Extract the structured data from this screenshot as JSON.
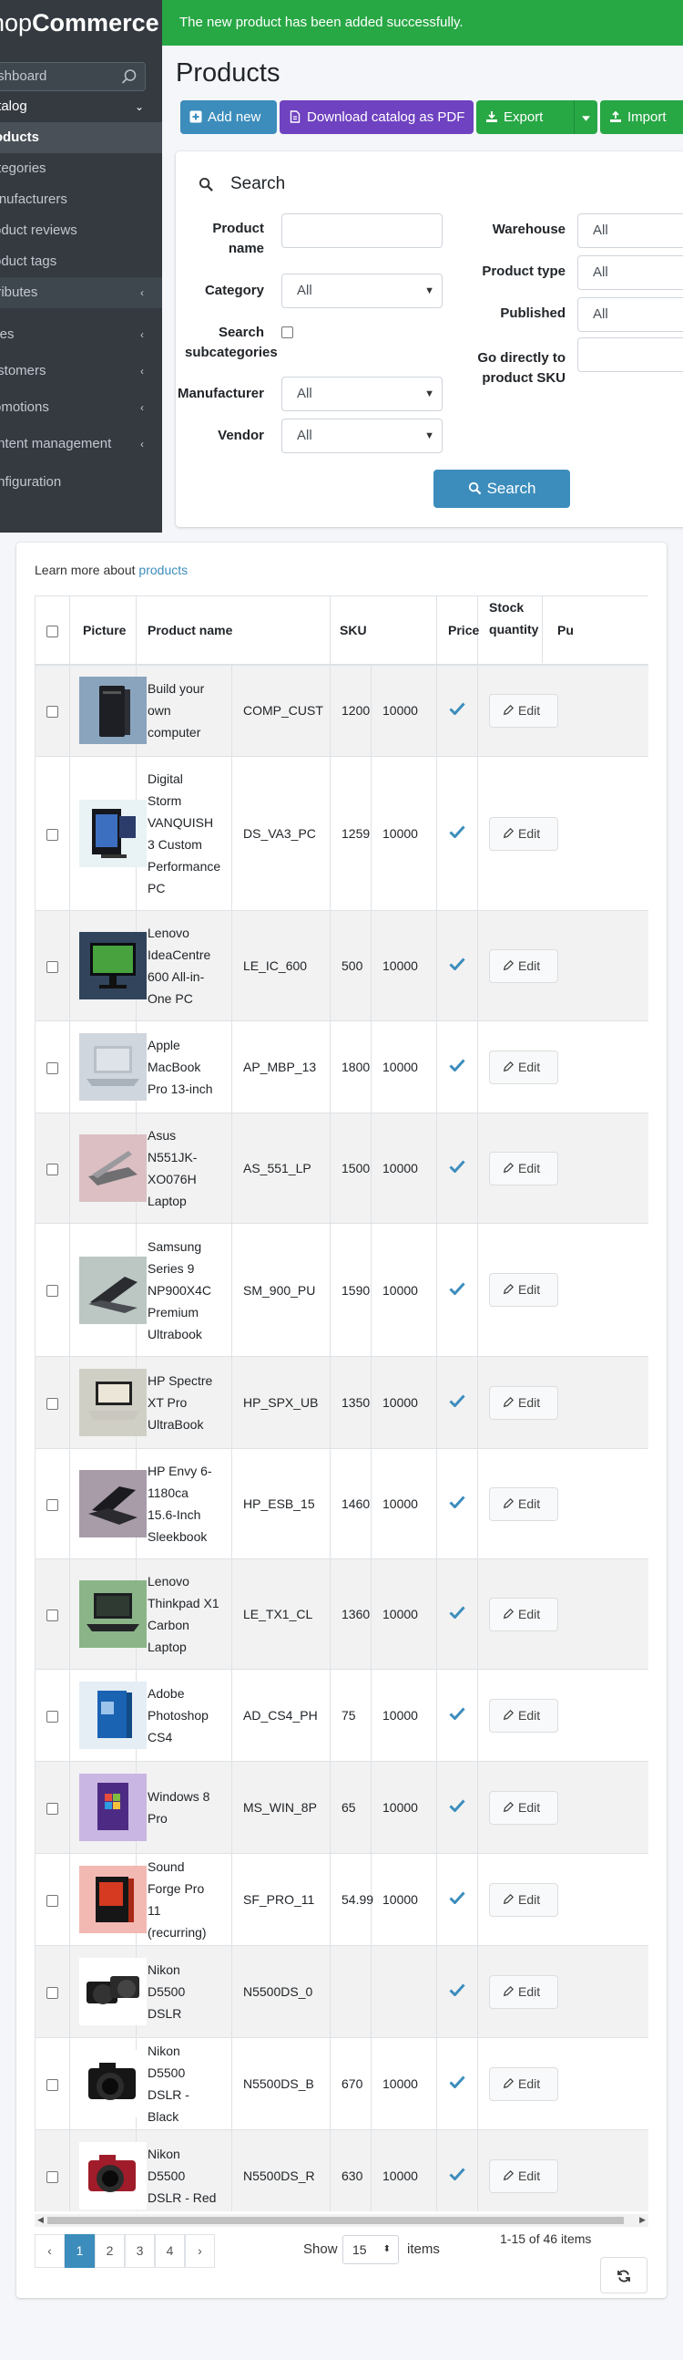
{
  "brand": {
    "logo_light": "nop",
    "logo_bold": "Commerce"
  },
  "alert": {
    "message": "The new product has been added successfully."
  },
  "sidebar": {
    "items": [
      {
        "label": "Dashboard",
        "chevron": ""
      },
      {
        "label": "Catalog",
        "chevron": "⌄"
      },
      {
        "label": "Products",
        "chevron": ""
      },
      {
        "label": "Categories",
        "chevron": ""
      },
      {
        "label": "Manufacturers",
        "chevron": ""
      },
      {
        "label": "Product reviews",
        "chevron": ""
      },
      {
        "label": "Product tags",
        "chevron": ""
      },
      {
        "label": "Attributes",
        "chevron": "‹"
      },
      {
        "label": "Sales",
        "chevron": "‹"
      },
      {
        "label": "Customers",
        "chevron": "‹"
      },
      {
        "label": "Promotions",
        "chevron": "‹"
      },
      {
        "label": "Content management",
        "chevron": "‹"
      },
      {
        "label": "Configuration",
        "chevron": ""
      }
    ]
  },
  "page": {
    "title": "Products"
  },
  "toolbar": {
    "add_new": "Add new",
    "download_pdf": "Download catalog as PDF",
    "export": "Export",
    "import": "Import",
    "colors": {
      "primary": "#3c8dbc",
      "purple": "#6f42c1",
      "success": "#28a745"
    }
  },
  "search": {
    "title": "Search",
    "product_name_label": "Product name",
    "product_name_value": "",
    "category_label": "Category",
    "category_value": "All",
    "search_subcategories_label": "Search subcategories",
    "manufacturer_label": "Manufacturer",
    "manufacturer_value": "All",
    "vendor_label": "Vendor",
    "vendor_value": "All",
    "warehouse_label": "Warehouse",
    "warehouse_value": "All",
    "product_type_label": "Product type",
    "product_type_value": "All",
    "published_label": "Published",
    "published_value": "All",
    "go_sku_label": "Go directly to product SKU",
    "go_sku_value": "",
    "search_button": "Search"
  },
  "products": {
    "learn_more_prefix": "Learn more about",
    "learn_more_link": "products",
    "columns": {
      "picture": "Picture",
      "name": "Product name",
      "sku": "SKU",
      "price": "Price",
      "stock": "Stock quantity",
      "published": "Pu"
    },
    "edit_label": "Edit",
    "rows": [
      {
        "name": "Build your own computer",
        "sku": "COMP_CUST",
        "price": "1200",
        "stock": "10000",
        "published": true,
        "thumb": "tower-pc"
      },
      {
        "name": "Digital Storm VANQUISH 3 Custom Performance PC",
        "sku": "DS_VA3_PC",
        "price": "1259",
        "stock": "10000",
        "published": true,
        "thumb": "gaming-pc"
      },
      {
        "name": "Lenovo IdeaCentre 600 All-in-One PC",
        "sku": "LE_IC_600",
        "price": "500",
        "stock": "10000",
        "published": true,
        "thumb": "all-in-one"
      },
      {
        "name": "Apple MacBook Pro 13-inch",
        "sku": "AP_MBP_13",
        "price": "1800",
        "stock": "10000",
        "published": true,
        "thumb": "macbook"
      },
      {
        "name": "Asus N551JK-XO076H Laptop",
        "sku": "AS_551_LP",
        "price": "1500",
        "stock": "10000",
        "published": true,
        "thumb": "laptop-silver"
      },
      {
        "name": "Samsung Series 9 NP900X4C Premium Ultrabook",
        "sku": "SM_900_PU",
        "price": "1590",
        "stock": "10000",
        "published": true,
        "thumb": "laptop-dark"
      },
      {
        "name": "HP Spectre XT Pro UltraBook",
        "sku": "HP_SPX_UB",
        "price": "1350",
        "stock": "10000",
        "published": true,
        "thumb": "laptop-open"
      },
      {
        "name": "HP Envy 6-1180ca 15.6-Inch Sleekbook",
        "sku": "HP_ESB_15",
        "price": "1460",
        "stock": "10000",
        "published": true,
        "thumb": "laptop-black"
      },
      {
        "name": "Lenovo Thinkpad X1 Carbon Laptop",
        "sku": "LE_TX1_CL",
        "price": "1360",
        "stock": "10000",
        "published": true,
        "thumb": "laptop-green"
      },
      {
        "name": "Adobe Photoshop CS4",
        "sku": "AD_CS4_PH",
        "price": "75",
        "stock": "10000",
        "published": true,
        "thumb": "box-blue"
      },
      {
        "name": "Windows 8 Pro",
        "sku": "MS_WIN_8P",
        "price": "65",
        "stock": "10000",
        "published": true,
        "thumb": "box-purple"
      },
      {
        "name": "Sound Forge Pro 11 (recurring)",
        "sku": "SF_PRO_11",
        "price": "54.99",
        "stock": "10000",
        "published": true,
        "thumb": "box-red"
      },
      {
        "name": "Nikon D5500 DSLR",
        "sku": "N5500DS_0",
        "price": "",
        "stock": "",
        "published": true,
        "thumb": "camera-duo"
      },
      {
        "name": "Nikon D5500 DSLR - Black",
        "sku": "N5500DS_B",
        "price": "670",
        "stock": "10000",
        "published": true,
        "thumb": "camera-black"
      },
      {
        "name": "Nikon D5500 DSLR - Red",
        "sku": "N5500DS_R",
        "price": "630",
        "stock": "10000",
        "published": true,
        "thumb": "camera-red"
      }
    ]
  },
  "pagination": {
    "pages": [
      "1",
      "2",
      "3",
      "4"
    ],
    "prev": "‹",
    "next": "›",
    "current": "1",
    "show_label": "Show",
    "page_size": "15",
    "items_label": "items",
    "range_text": "1-15 of 46 items"
  }
}
